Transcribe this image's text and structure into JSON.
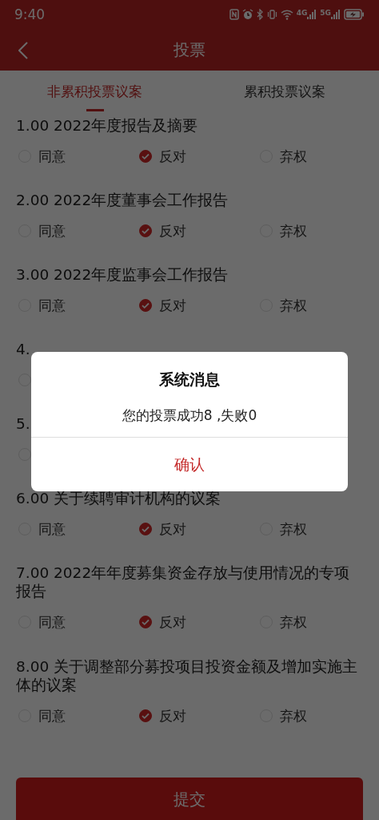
{
  "status_bar": {
    "time": "9:40",
    "network_labels": [
      "4G",
      "5G"
    ]
  },
  "header": {
    "title": "投票"
  },
  "tabs": [
    {
      "label": "非累积投票议案",
      "selected": true
    },
    {
      "label": "累积投票议案",
      "selected": false
    }
  ],
  "proposals": [
    {
      "title": "1.00 2022年度报告及摘要",
      "options": [
        {
          "label": "同意",
          "selected": false
        },
        {
          "label": "反对",
          "selected": true
        },
        {
          "label": "弃权",
          "selected": false
        }
      ]
    },
    {
      "title": "2.00 2022年度董事会工作报告",
      "options": [
        {
          "label": "同意",
          "selected": false
        },
        {
          "label": "反对",
          "selected": true
        },
        {
          "label": "弃权",
          "selected": false
        }
      ]
    },
    {
      "title": "3.00 2022年度监事会工作报告",
      "options": [
        {
          "label": "同意",
          "selected": false
        },
        {
          "label": "反对",
          "selected": true
        },
        {
          "label": "弃权",
          "selected": false
        }
      ]
    },
    {
      "title": "4.",
      "options": [
        {
          "selected": false
        }
      ]
    },
    {
      "title": "5.",
      "options": [
        {
          "selected": false
        }
      ]
    },
    {
      "title": "6.00 关于续聘审计机构的议案",
      "options": [
        {
          "label": "同意",
          "selected": false
        },
        {
          "label": "反对",
          "selected": true
        },
        {
          "label": "弃权",
          "selected": false
        }
      ]
    },
    {
      "title": "7.00 2022年年度募集资金存放与使用情况的专项报告",
      "options": [
        {
          "label": "同意",
          "selected": false
        },
        {
          "label": "反对",
          "selected": true
        },
        {
          "label": "弃权",
          "selected": false
        }
      ]
    },
    {
      "title": "8.00 关于调整部分募投项目投资金额及增加实施主体的议案",
      "options": [
        {
          "label": "同意",
          "selected": false
        },
        {
          "label": "反对",
          "selected": true
        },
        {
          "label": "弃权",
          "selected": false
        }
      ]
    }
  ],
  "submit_button": "提交",
  "dialog": {
    "title": "系统消息",
    "message": "您的投票成功8 ,失败0",
    "confirm": "确认"
  }
}
